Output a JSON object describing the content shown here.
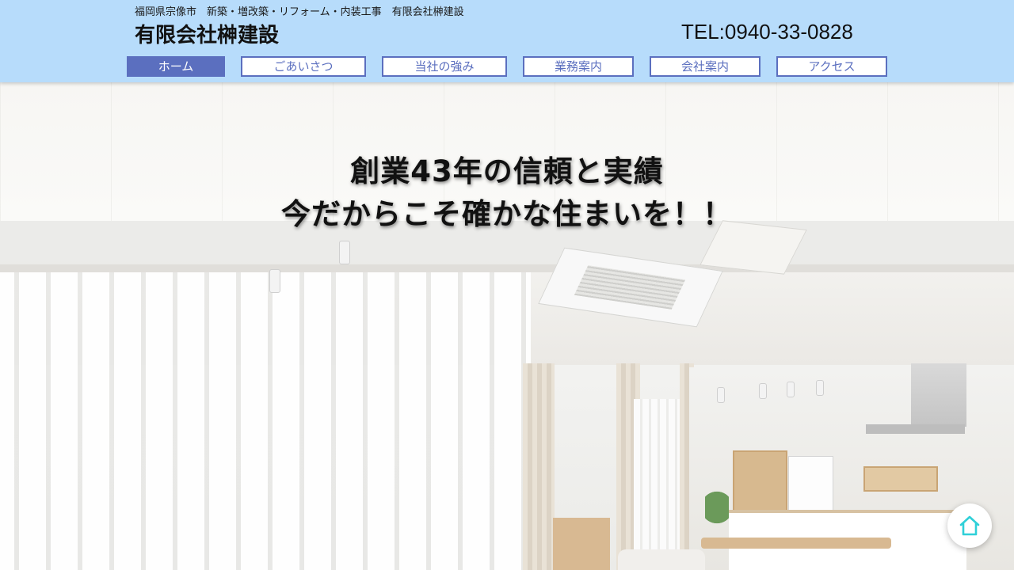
{
  "header": {
    "tagline": "福岡県宗像市　新築・増改築・リフォーム・内装工事　有限会社榊建設",
    "company_name": "有限会社榊建設",
    "tel": "TEL:0940-33-0828",
    "background_color": "#b7dcfb"
  },
  "nav": {
    "accent_color": "#5b6fbf",
    "items": [
      {
        "label": "ホーム",
        "active": true
      },
      {
        "label": "ごあいさつ",
        "active": false
      },
      {
        "label": "当社の強み",
        "active": false
      },
      {
        "label": "業務案内",
        "active": false
      },
      {
        "label": "会社案内",
        "active": false
      },
      {
        "label": "アクセス",
        "active": false
      }
    ]
  },
  "hero": {
    "headline_line1": "創業43年の信頼と実績",
    "headline_line2": "今だからこそ確かな住まいを！！"
  },
  "floating_button": {
    "icon": "home-icon",
    "icon_color": "#2fd0d8"
  }
}
